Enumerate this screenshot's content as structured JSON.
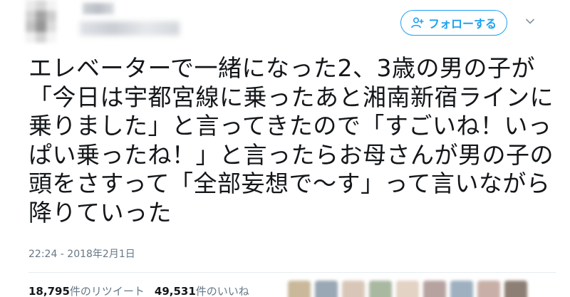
{
  "header": {
    "follow_label": "フォローする",
    "follow_icon": "add-person-icon",
    "menu_icon": "chevron-down-icon",
    "accent_color": "#1da1f2"
  },
  "tweet": {
    "text": "エレベーターで一緒になった2、3歳の男の子が「今日は宇都宮線に乗ったあと湘南新宿ラインに乗りました」と言ってきたので「すごいね！いっぱい乗ったね！」と言ったらお母さんが男の子の頭をさすって「全部妄想で〜す」って言いながら降りていった",
    "timestamp": "22:24 - 2018年2月1日"
  },
  "stats": {
    "retweets_count": "18,795",
    "retweets_label": "件のリツイート",
    "likes_count": "49,531",
    "likes_label": "件のいいね"
  }
}
